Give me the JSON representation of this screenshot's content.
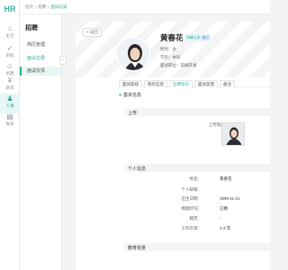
{
  "app": {
    "logo": "HR"
  },
  "rail": [
    {
      "label": "主页",
      "icon": "home-icon"
    },
    {
      "label": "审批",
      "icon": "approve-icon"
    },
    {
      "label": "招聘",
      "icon": "recruit-icon"
    },
    {
      "label": "薪资",
      "icon": "salary-icon"
    },
    {
      "label": "人事",
      "icon": "personnel-icon"
    },
    {
      "label": "账表",
      "icon": "report-icon"
    }
  ],
  "sidebar": {
    "title": "招聘",
    "items": [
      "简历管理",
      "面试记录",
      "面试反馈"
    ]
  },
  "breadcrumb": [
    "首页",
    "招聘",
    "面试记录"
  ],
  "back_label": "< 返回",
  "candidate": {
    "name": "黄春花",
    "badge1": "待确认到岗",
    "badge2": "通过",
    "gender": "性别：女",
    "education": "学历：本科",
    "position": "面试职位：前端开发"
  },
  "tabs": [
    "面试安排",
    "简历信息",
    "应聘登记",
    "面试反馈",
    "备注"
  ],
  "tip": "基本信息",
  "sections": {
    "photo": "上传",
    "personal": "个人信息",
    "education": "教育背景"
  },
  "photo_label": "上传照片：",
  "fields": [
    {
      "label": "姓名：",
      "value": "黄春花"
    },
    {
      "label": "个人邮箱：",
      "value": ""
    },
    {
      "label": "出生日期：",
      "value": "1995-11-21"
    },
    {
      "label": "婚姻状况：",
      "value": "已婚"
    },
    {
      "label": "籍贯：",
      "value": "-"
    },
    {
      "label": "工作年限：",
      "value": "1-3 年"
    }
  ],
  "colors": {
    "accent": "#2fae9c",
    "accent_light": "#e6f7f5"
  }
}
